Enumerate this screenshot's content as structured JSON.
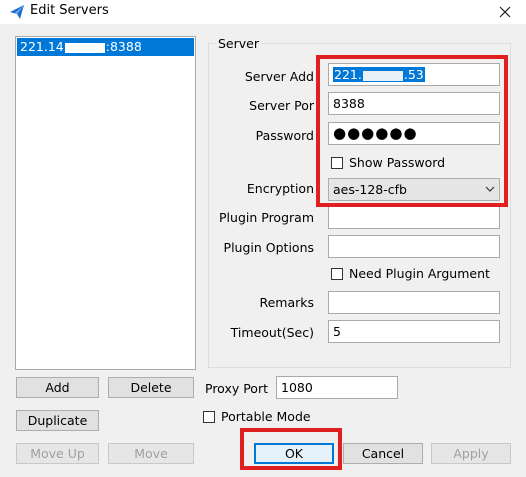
{
  "window": {
    "title": "Edit Servers",
    "icon": "paper-plane-icon",
    "close_icon": "close-icon"
  },
  "server_list": {
    "items": [
      {
        "label_start": "221.14",
        "label_end": ":8388"
      }
    ]
  },
  "server_group": {
    "title": "Server",
    "server_address": {
      "label": "Server Add",
      "value_start": "221.",
      "value_end": ".53"
    },
    "server_port": {
      "label": "Server Por",
      "value": "8388"
    },
    "password": {
      "label": "Password",
      "value": "●●●●●●"
    },
    "show_password": {
      "label": "Show Password",
      "checked": false
    },
    "encryption": {
      "label": "Encryption",
      "value": "aes-128-cfb"
    },
    "plugin_program": {
      "label": "Plugin Program",
      "value": ""
    },
    "plugin_options": {
      "label": "Plugin Options",
      "value": ""
    },
    "need_plugin_argument": {
      "label": "Need Plugin Argument",
      "checked": false
    },
    "remarks": {
      "label": "Remarks",
      "value": ""
    },
    "timeout": {
      "label": "Timeout(Sec)",
      "value": "5"
    }
  },
  "buttons": {
    "add": "Add",
    "delete": "Delete",
    "duplicate": "Duplicate",
    "move_up": "Move Up",
    "move_down": "Move",
    "ok": "OK",
    "cancel": "Cancel",
    "apply": "Apply"
  },
  "proxy_port": {
    "label": "Proxy Port",
    "value": "1080"
  },
  "portable_mode": {
    "label": "Portable Mode",
    "checked": false
  },
  "annotation_color": "#e02020",
  "accent_color": "#0078d7"
}
